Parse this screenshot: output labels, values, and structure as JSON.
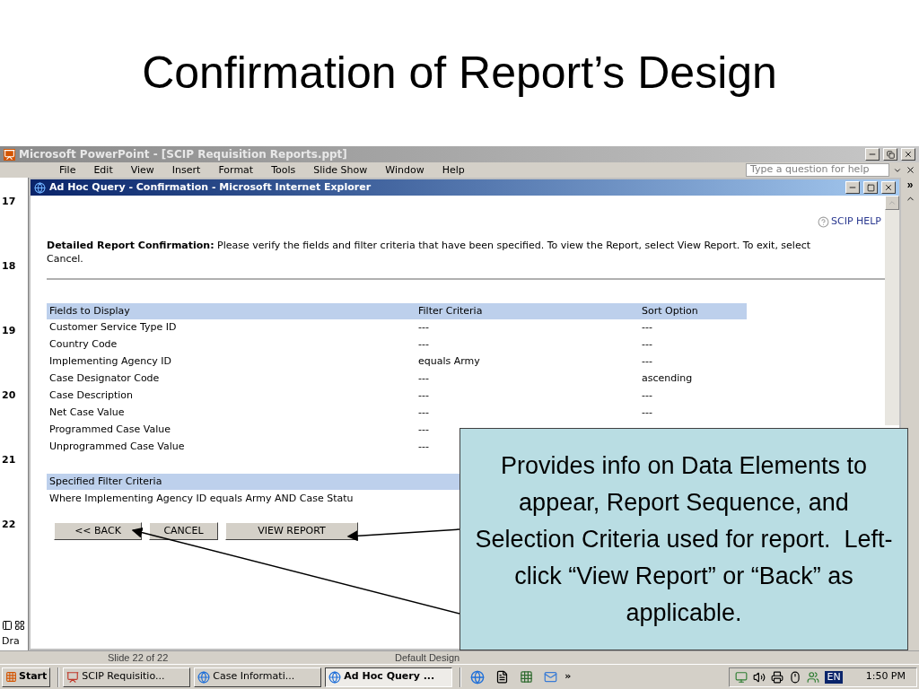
{
  "slide_title": "Confirmation of Report’s Design",
  "ppt": {
    "title": "Microsoft PowerPoint - [SCIP Requisition Reports.ppt]",
    "menu": [
      "File",
      "Edit",
      "View",
      "Insert",
      "Format",
      "Tools",
      "Slide Show",
      "Window",
      "Help"
    ],
    "help_placeholder": "Type a question for help",
    "toolbar_more": "»",
    "slide_numbers": [
      "17",
      "18",
      "19",
      "20",
      "21",
      "22"
    ],
    "draw_label": "Dra",
    "status": [
      "Slide 22 of 22",
      "Default Design"
    ]
  },
  "ie": {
    "title": "Ad Hoc Query - Confirmation - Microsoft Internet Explorer",
    "help_link": "SCIP HELP",
    "intro": "**Detailed Report Confirmation:** Please verify the fields and filter criteria that have been specified. To view the Report, select View Report. To exit, select Cancel.",
    "table": {
      "columns": [
        "Fields to Display",
        "Filter Criteria",
        "Sort Option"
      ],
      "rows": [
        {
          "field": "Customer Service Type ID",
          "filter": "---",
          "sort": "---"
        },
        {
          "field": "Country Code",
          "filter": "---",
          "sort": "---"
        },
        {
          "field": "Implementing Agency ID",
          "filter": "equals Army",
          "sort": "---"
        },
        {
          "field": "Case Designator Code",
          "filter": "---",
          "sort": "ascending"
        },
        {
          "field": "Case Description",
          "filter": "---",
          "sort": "---"
        },
        {
          "field": "Net Case Value",
          "filter": "---",
          "sort": "---"
        },
        {
          "field": "Programmed Case Value",
          "filter": "---"
        },
        {
          "field": "Unprogrammed Case Value",
          "filter": "---"
        }
      ]
    },
    "filter_section": {
      "heading": "Specified Filter Criteria",
      "text": "Where Implementing Agency ID equals Army AND Case Statu"
    },
    "buttons": [
      "<< BACK",
      "CANCEL",
      "VIEW REPORT"
    ]
  },
  "callout": {
    "text": "Provides info on Data Elements to appear, Report Sequence, and  Selection Criteria used for report.  Left-click “View Report” or “Back” as applicable."
  },
  "taskbar": {
    "start": "Start",
    "tasks": [
      {
        "label": "SCIP Requisitio...",
        "kind": "ppt",
        "selected": false
      },
      {
        "label": "Case Informati...",
        "kind": "ie",
        "selected": false
      },
      {
        "label": "Ad Hoc Query ...",
        "kind": "ie",
        "selected": true
      }
    ],
    "more": "»",
    "language": "EN",
    "clock": "1:50 PM"
  }
}
